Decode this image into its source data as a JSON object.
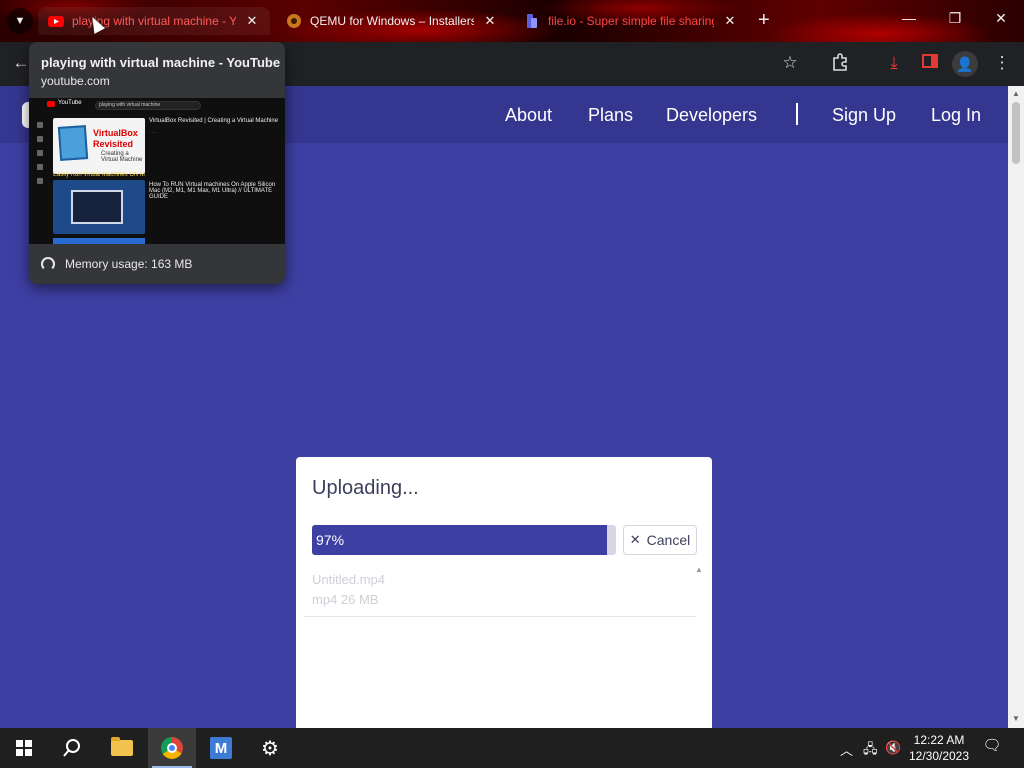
{
  "browser": {
    "tabs": [
      {
        "title": "playing with virtual machine - YouTube",
        "favicon_color": "#ff0000"
      },
      {
        "title": "QEMU for Windows – Installers",
        "favicon_color": "#c9761c"
      },
      {
        "title": "file.io - Super simple file sharing",
        "favicon_color": "#5a5fe0"
      }
    ],
    "hover_card": {
      "title": "playing with virtual machine - YouTube",
      "domain": "youtube.com",
      "memory": "Memory usage: 163 MB",
      "preview": {
        "logo_text": "YouTube",
        "search_text": "playing with virtual machine",
        "video1_title": "VirtualBox Revisited | Creating a Virtual Machine",
        "video1_thumb_line1": "VirtualBox",
        "video1_thumb_line2": "Revisited",
        "video1_thumb_line3": "Creating a Virtual Machine",
        "video2_title": "Easily Run Virtual Machines ON M1 / M2 Mac",
        "video2_side_title": "How To RUN Virtual machines On Apple Silicon Mac (M2, M1, M1 Max, M1 Ultra) // ULTIMATE GUIDE"
      }
    }
  },
  "site": {
    "nav": [
      "About",
      "Plans",
      "Developers",
      "Sign Up",
      "Log In"
    ]
  },
  "upload": {
    "title": "Uploading...",
    "progress": 0.97,
    "progress_label": "97%",
    "cancel_label": "Cancel",
    "files": [
      {
        "name": "Untitled.mp4",
        "meta": "mp4 26 MB"
      }
    ]
  },
  "taskbar": {
    "time": "12:22 AM",
    "date": "12/30/2023"
  },
  "colors": {
    "page_bg": "#3e3fa3",
    "progress_fill": "#3e3fa3",
    "tab_red_text": "#ff4545"
  }
}
